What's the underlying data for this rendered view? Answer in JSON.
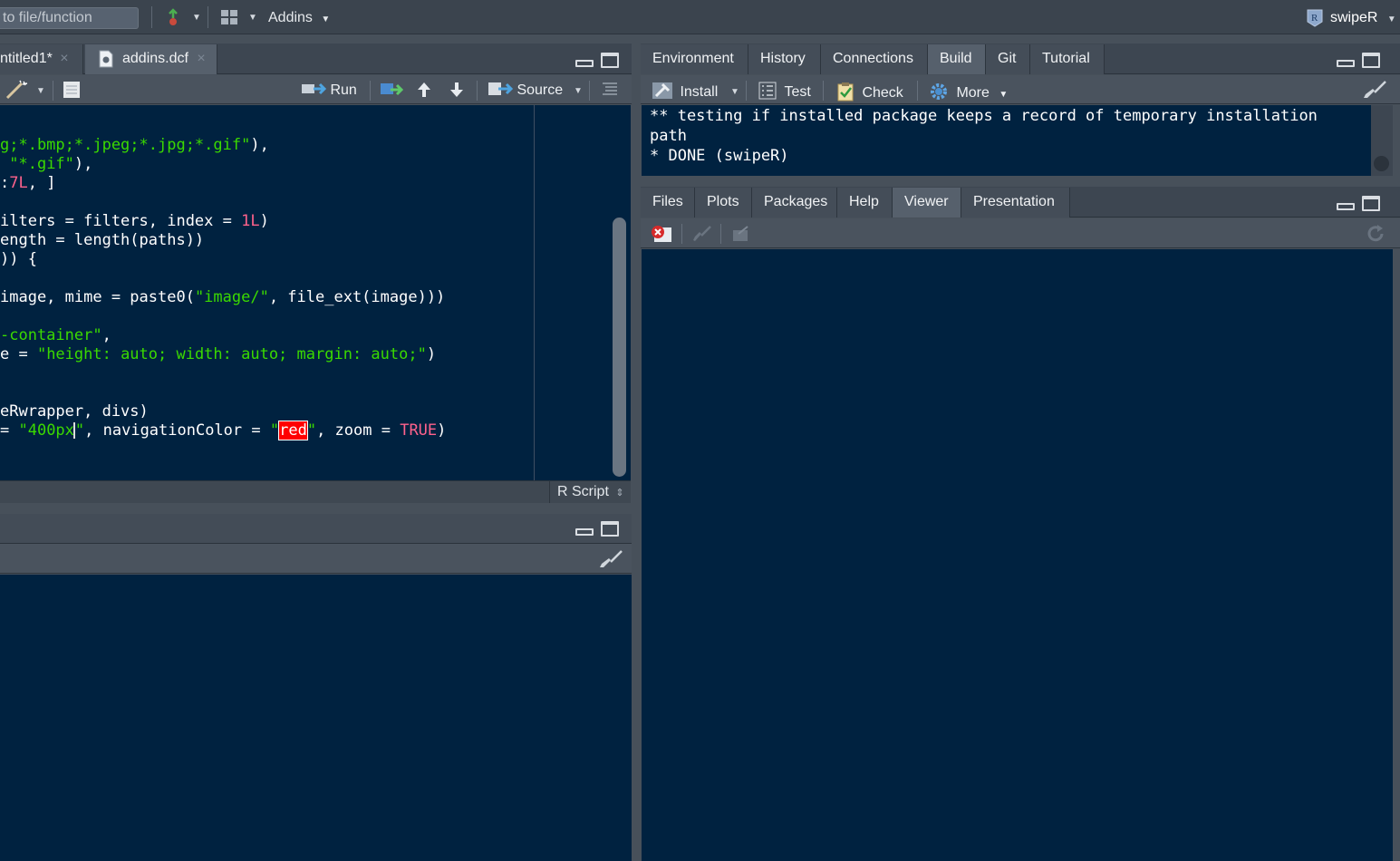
{
  "topbar": {
    "goto_placeholder": "to file/function",
    "addins_label": "Addins",
    "project_name": "swipeR"
  },
  "editor": {
    "tabs": [
      {
        "label": "ntitled1*",
        "close": "×"
      },
      {
        "label": "addins.dcf",
        "close": "×"
      }
    ],
    "toolbar": {
      "run_label": "Run",
      "source_label": "Source"
    },
    "code_lines": [
      {
        "t": "g;*.bmp;*.jpeg;*.jpg;*.gif\"),"
      },
      {
        "t": " \"*.gif\"),"
      },
      {
        "t": ":7L, ]"
      },
      {
        "t": "ilters = filters, index = 1L)"
      },
      {
        "t": "ength = length(paths))"
      },
      {
        "t": ")) {"
      },
      {
        "t": "image, mime = paste0(\"image/\", file_ext(image)))"
      },
      {
        "t": "-container\","
      },
      {
        "t": "e = \"height: auto; width: auto; margin: auto;\")"
      },
      {
        "t": "eRwrapper, divs)"
      },
      {
        "t": "= \"400px\", navigationColor = \"red\", zoom = TRUE)"
      }
    ],
    "status_mode": "R Script"
  },
  "build_pane": {
    "tabs": [
      "Environment",
      "History",
      "Connections",
      "Build",
      "Git",
      "Tutorial"
    ],
    "active_tab": "Build",
    "toolbar": {
      "install_label": "Install",
      "test_label": "Test",
      "check_label": "Check",
      "more_label": "More"
    },
    "output": {
      "line1": "** testing if installed package keeps a record of temporary installation",
      "line2": "path",
      "line3": "* DONE (swipeR)"
    }
  },
  "viewer_pane": {
    "tabs": [
      "Files",
      "Plots",
      "Packages",
      "Help",
      "Viewer",
      "Presentation"
    ],
    "active_tab": "Viewer"
  },
  "colors": {
    "background": "#002240",
    "chrome": "#47505a",
    "string": "#3ad900",
    "number": "#ff628c",
    "highlight": "#ff0000"
  }
}
